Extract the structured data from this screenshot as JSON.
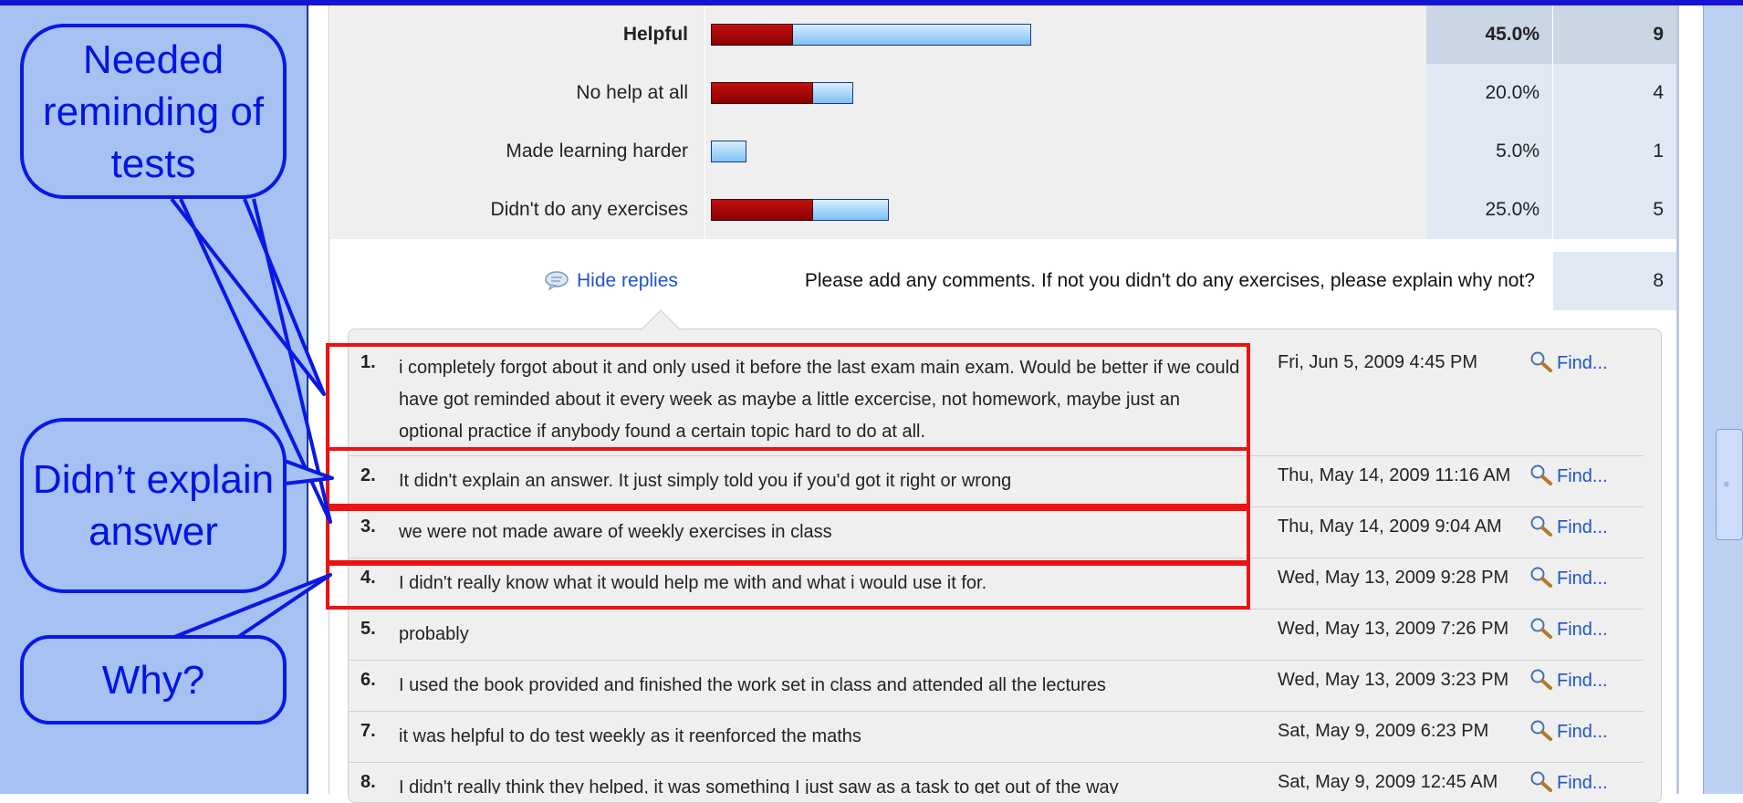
{
  "survey": {
    "rows": [
      {
        "label": "Helpful",
        "pct": "45.0%",
        "count": "9",
        "bold": true,
        "red_fraction": 0.225,
        "blue_fraction": 0.45
      },
      {
        "label": "No help at all",
        "pct": "20.0%",
        "count": "4",
        "bold": false,
        "red_fraction": 0.28,
        "blue_fraction": 0.2
      },
      {
        "label": "Made learning harder",
        "pct": "5.0%",
        "count": "1",
        "bold": false,
        "red_fraction": 0.0,
        "blue_fraction": 0.05
      },
      {
        "label": "Didn't do any exercises",
        "pct": "25.0%",
        "count": "5",
        "bold": false,
        "red_fraction": 0.28,
        "blue_fraction": 0.25
      }
    ]
  },
  "comments": {
    "hide_replies_label": "Hide replies",
    "question": "Please add any comments. If not you didn't do any exercises, please explain why not?",
    "count": "8",
    "replies": [
      {
        "num": "1.",
        "text": "i completely forgot about it and only used it before the last exam main exam. Would be better if we could have got reminded about it every week as maybe a little excercise, not homework, maybe just an optional practice if anybody found a certain topic hard to do at all.",
        "date": "Fri, Jun 5, 2009 4:45 PM",
        "find": "Find..."
      },
      {
        "num": "2.",
        "text": "It didn't explain an answer. It just simply told you if you'd got it right or wrong",
        "date": "Thu, May 14, 2009 11:16 AM",
        "find": "Find..."
      },
      {
        "num": "3.",
        "text": "we were not made aware of weekly exercises in class",
        "date": "Thu, May 14, 2009 9:04 AM",
        "find": "Find..."
      },
      {
        "num": "4.",
        "text": "I didn't really know what it would help me with and what i would use it for.",
        "date": "Wed, May 13, 2009 9:28 PM",
        "find": "Find..."
      },
      {
        "num": "5.",
        "text": "probably",
        "date": "Wed, May 13, 2009 7:26 PM",
        "find": "Find..."
      },
      {
        "num": "6.",
        "text": "I used the book provided and finished the work set in class and attended all the lectures",
        "date": "Wed, May 13, 2009 3:23 PM",
        "find": "Find..."
      },
      {
        "num": "7.",
        "text": "it was helpful to do test weekly as it reenforced the maths",
        "date": "Sat, May 9, 2009 6:23 PM",
        "find": "Find..."
      },
      {
        "num": "8.",
        "text": "I didn't really think they helped, it was something I just saw as a task to get out of the way",
        "date": "Sat, May 9, 2009 12:45 AM",
        "find": "Find..."
      }
    ]
  },
  "callouts": {
    "reminding": "Needed reminding of tests",
    "explain": "Didn’t explain answer",
    "why": "Why?"
  },
  "colors": {
    "callout_fill": "#a6c1f2",
    "callout_stroke": "#0a18e6",
    "highlight": "#ee1111"
  }
}
